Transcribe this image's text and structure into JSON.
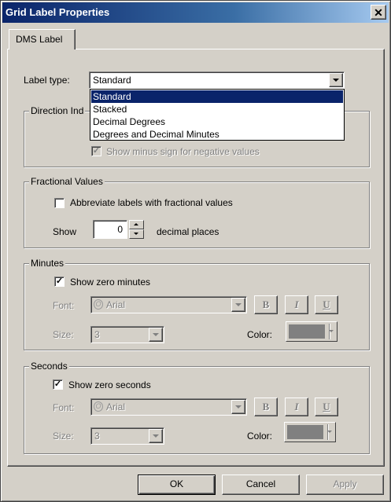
{
  "window": {
    "title": "Grid Label Properties"
  },
  "tabs": [
    {
      "label": "DMS Label"
    }
  ],
  "label_type": {
    "label": "Label type:",
    "selected": "Standard",
    "options": [
      "Standard",
      "Stacked",
      "Decimal Degrees",
      "Degrees and Decimal Minutes"
    ]
  },
  "direction": {
    "title_visible": "Direction Ind",
    "show_minus_label": "Show minus sign for negative values",
    "show_minus_checked": true
  },
  "fractional": {
    "title": "Fractional Values",
    "abbreviate_label": "Abbreviate labels with fractional values",
    "abbreviate_checked": false,
    "show_label": "Show",
    "value": "0",
    "suffix": "decimal places"
  },
  "minutes": {
    "title": "Minutes",
    "show_zero_label": "Show zero minutes",
    "show_zero_checked": true,
    "font_label": "Font:",
    "font_value": "Arial",
    "size_label": "Size:",
    "size_value": "3",
    "color_label": "Color:",
    "color": "#808080",
    "bold": "B",
    "italic": "I",
    "underline": "U"
  },
  "seconds": {
    "title": "Seconds",
    "show_zero_label": "Show zero seconds",
    "show_zero_checked": true,
    "font_label": "Font:",
    "font_value": "Arial",
    "size_label": "Size:",
    "size_value": "3",
    "color_label": "Color:",
    "color": "#808080",
    "bold": "B",
    "italic": "I",
    "underline": "U"
  },
  "buttons": {
    "ok": "OK",
    "cancel": "Cancel",
    "apply": "Apply"
  },
  "icons": {
    "close": "close-icon",
    "font": "opentype-font-icon",
    "check": "checkmark-icon"
  }
}
